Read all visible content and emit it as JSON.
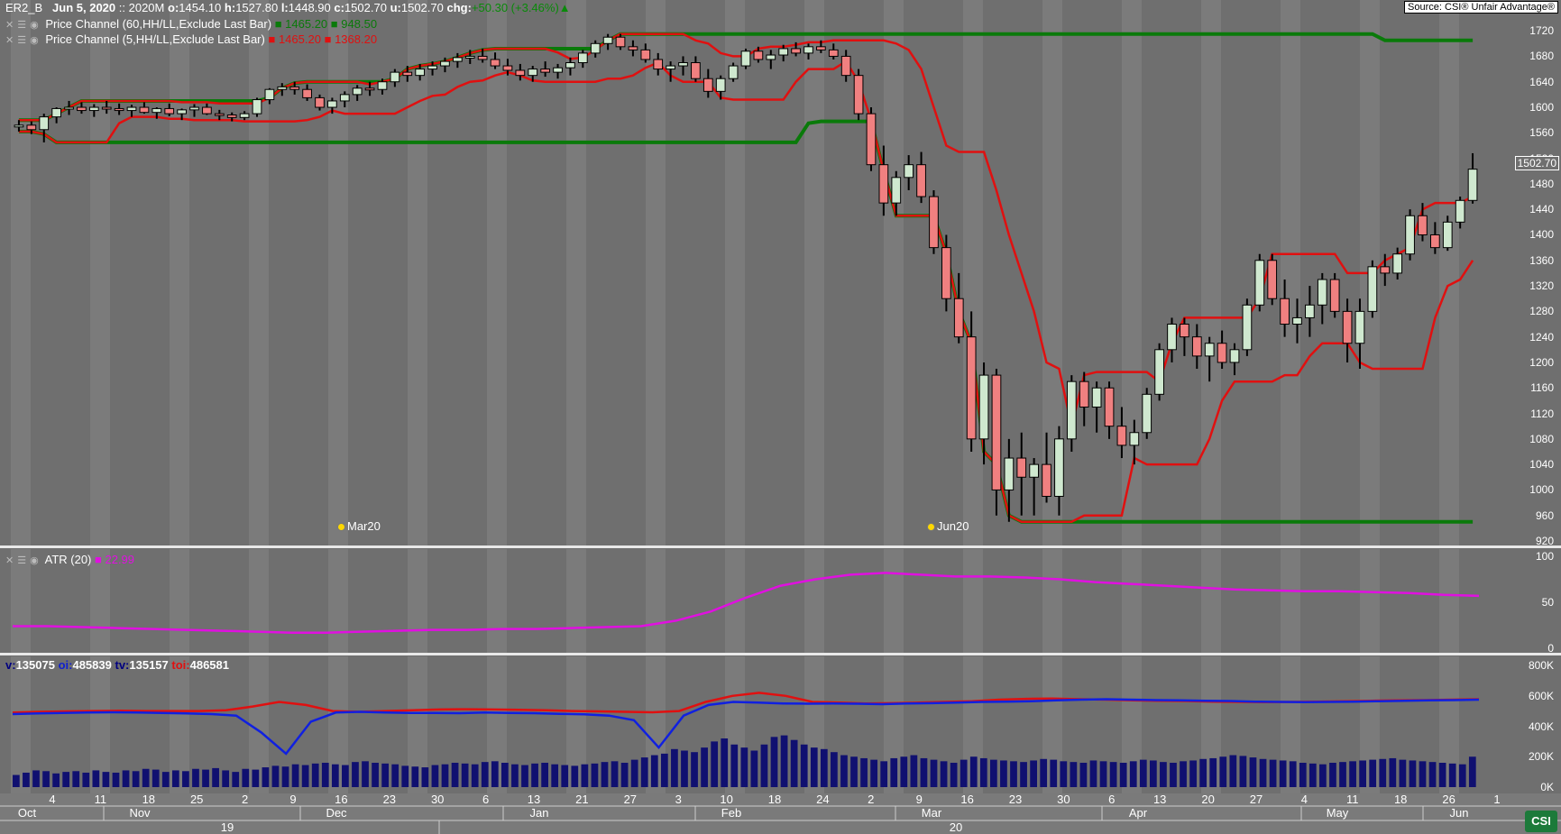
{
  "header": {
    "symbol": "ER2_B",
    "date": "Jun  5, 2020",
    "contract": ":: 2020M",
    "open_label": "o:",
    "open": "1454.10",
    "high_label": "h:",
    "high": "1527.80",
    "low_label": "l:",
    "low": "1448.90",
    "close_label": "c:",
    "close": "1502.70",
    "u_label": "u:",
    "u": "1502.70",
    "chg_label": "chg:",
    "chg": "+50.30 (+3.46%)"
  },
  "source": "Source: CSI® Unfair Advantage®",
  "indicators": {
    "pc60": {
      "label": "Price Channel (60,HH/LL,Exclude Last Bar)",
      "v1": "1465.20",
      "v2": "948.50",
      "color": "#0a7a0a"
    },
    "pc5": {
      "label": "Price Channel (5,HH/LL,Exclude Last Bar)",
      "v1": "1465.20",
      "v2": "1368.20",
      "color": "#e01010"
    },
    "atr": {
      "label": "ATR (20)",
      "value": "22.99",
      "color": "#e010e0"
    }
  },
  "volume_header": {
    "v_label": "v:",
    "v": "135075",
    "oi_label": "oi:",
    "oi": "485839",
    "tv_label": "tv:",
    "tv": "135157",
    "toi_label": "toi:",
    "toi": "486581"
  },
  "last_price_box": "1502.70",
  "markers": [
    {
      "label": "Mar20"
    },
    {
      "label": "Jun20"
    }
  ],
  "price_axis": [
    "1720",
    "1680",
    "1640",
    "1600",
    "1560",
    "1520",
    "1480",
    "1440",
    "1400",
    "1360",
    "1320",
    "1280",
    "1240",
    "1200",
    "1160",
    "1120",
    "1080",
    "1040",
    "1000",
    "960",
    "920"
  ],
  "atr_axis": [
    "100",
    "50",
    "0"
  ],
  "vol_axis": [
    "800K",
    "600K",
    "400K",
    "200K",
    "0K"
  ],
  "time_axis": {
    "days": [
      "4",
      "11",
      "18",
      "25",
      "2",
      "9",
      "16",
      "23",
      "30",
      "6",
      "13",
      "21",
      "27",
      "3",
      "10",
      "18",
      "24",
      "2",
      "9",
      "16",
      "23",
      "30",
      "6",
      "13",
      "20",
      "27",
      "4",
      "11",
      "18",
      "26",
      "1"
    ],
    "months": [
      "Oct",
      "Nov",
      "Dec",
      "Jan",
      "Feb",
      "Mar",
      "Apr",
      "May",
      "Jun"
    ],
    "years": [
      "19",
      "20"
    ]
  },
  "chart_data": {
    "type": "candlestick",
    "ylim": [
      920,
      1740
    ],
    "candles": [
      [
        1570,
        1580,
        1562,
        1572
      ],
      [
        1572,
        1578,
        1558,
        1565
      ],
      [
        1565,
        1590,
        1545,
        1585
      ],
      [
        1585,
        1600,
        1575,
        1598
      ],
      [
        1598,
        1610,
        1588,
        1600
      ],
      [
        1600,
        1608,
        1590,
        1595
      ],
      [
        1595,
        1605,
        1585,
        1600
      ],
      [
        1600,
        1610,
        1590,
        1598
      ],
      [
        1598,
        1606,
        1588,
        1595
      ],
      [
        1595,
        1604,
        1585,
        1600
      ],
      [
        1600,
        1608,
        1590,
        1592
      ],
      [
        1592,
        1600,
        1582,
        1598
      ],
      [
        1598,
        1606,
        1586,
        1590
      ],
      [
        1590,
        1598,
        1580,
        1596
      ],
      [
        1596,
        1605,
        1585,
        1600
      ],
      [
        1600,
        1606,
        1588,
        1590
      ],
      [
        1590,
        1596,
        1580,
        1588
      ],
      [
        1588,
        1592,
        1578,
        1584
      ],
      [
        1584,
        1594,
        1580,
        1590
      ],
      [
        1590,
        1615,
        1585,
        1612
      ],
      [
        1612,
        1630,
        1605,
        1628
      ],
      [
        1628,
        1638,
        1618,
        1632
      ],
      [
        1632,
        1640,
        1620,
        1628
      ],
      [
        1628,
        1636,
        1610,
        1615
      ],
      [
        1615,
        1620,
        1595,
        1600
      ],
      [
        1600,
        1615,
        1590,
        1610
      ],
      [
        1610,
        1625,
        1600,
        1620
      ],
      [
        1620,
        1635,
        1610,
        1630
      ],
      [
        1630,
        1640,
        1618,
        1628
      ],
      [
        1628,
        1645,
        1620,
        1640
      ],
      [
        1640,
        1660,
        1632,
        1655
      ],
      [
        1655,
        1665,
        1640,
        1650
      ],
      [
        1650,
        1668,
        1642,
        1660
      ],
      [
        1660,
        1672,
        1650,
        1665
      ],
      [
        1665,
        1678,
        1655,
        1672
      ],
      [
        1672,
        1685,
        1662,
        1678
      ],
      [
        1678,
        1690,
        1668,
        1680
      ],
      [
        1680,
        1692,
        1670,
        1675
      ],
      [
        1675,
        1686,
        1660,
        1665
      ],
      [
        1665,
        1676,
        1650,
        1658
      ],
      [
        1658,
        1668,
        1642,
        1650
      ],
      [
        1650,
        1665,
        1640,
        1660
      ],
      [
        1660,
        1672,
        1648,
        1655
      ],
      [
        1655,
        1668,
        1645,
        1662
      ],
      [
        1662,
        1678,
        1650,
        1670
      ],
      [
        1670,
        1690,
        1662,
        1685
      ],
      [
        1685,
        1705,
        1678,
        1700
      ],
      [
        1700,
        1715,
        1690,
        1710
      ],
      [
        1710,
        1715,
        1690,
        1695
      ],
      [
        1695,
        1705,
        1680,
        1690
      ],
      [
        1690,
        1700,
        1670,
        1675
      ],
      [
        1675,
        1685,
        1650,
        1660
      ],
      [
        1660,
        1672,
        1640,
        1665
      ],
      [
        1665,
        1680,
        1650,
        1670
      ],
      [
        1670,
        1680,
        1640,
        1645
      ],
      [
        1645,
        1660,
        1615,
        1625
      ],
      [
        1625,
        1650,
        1612,
        1645
      ],
      [
        1645,
        1670,
        1640,
        1665
      ],
      [
        1665,
        1692,
        1660,
        1688
      ],
      [
        1688,
        1695,
        1670,
        1675
      ],
      [
        1675,
        1690,
        1660,
        1682
      ],
      [
        1682,
        1698,
        1672,
        1692
      ],
      [
        1692,
        1702,
        1680,
        1685
      ],
      [
        1685,
        1700,
        1675,
        1695
      ],
      [
        1695,
        1705,
        1685,
        1690
      ],
      [
        1690,
        1700,
        1675,
        1680
      ],
      [
        1680,
        1690,
        1640,
        1650
      ],
      [
        1650,
        1660,
        1580,
        1590
      ],
      [
        1590,
        1600,
        1500,
        1510
      ],
      [
        1510,
        1540,
        1430,
        1450
      ],
      [
        1450,
        1500,
        1430,
        1490
      ],
      [
        1490,
        1525,
        1470,
        1510
      ],
      [
        1510,
        1530,
        1450,
        1460
      ],
      [
        1460,
        1470,
        1370,
        1380
      ],
      [
        1380,
        1400,
        1280,
        1300
      ],
      [
        1300,
        1340,
        1230,
        1240
      ],
      [
        1240,
        1280,
        1060,
        1080
      ],
      [
        1080,
        1200,
        1040,
        1180
      ],
      [
        1180,
        1190,
        960,
        1000
      ],
      [
        1000,
        1080,
        950,
        1050
      ],
      [
        1050,
        1090,
        960,
        1020
      ],
      [
        1020,
        1050,
        960,
        1040
      ],
      [
        1040,
        1090,
        980,
        990
      ],
      [
        990,
        1100,
        960,
        1080
      ],
      [
        1080,
        1180,
        1060,
        1170
      ],
      [
        1170,
        1185,
        1100,
        1130
      ],
      [
        1130,
        1170,
        1090,
        1160
      ],
      [
        1160,
        1170,
        1080,
        1100
      ],
      [
        1100,
        1130,
        1050,
        1070
      ],
      [
        1070,
        1110,
        1040,
        1090
      ],
      [
        1090,
        1160,
        1080,
        1150
      ],
      [
        1150,
        1230,
        1140,
        1220
      ],
      [
        1220,
        1270,
        1200,
        1260
      ],
      [
        1260,
        1270,
        1210,
        1240
      ],
      [
        1240,
        1260,
        1190,
        1210
      ],
      [
        1210,
        1240,
        1170,
        1230
      ],
      [
        1230,
        1250,
        1190,
        1200
      ],
      [
        1200,
        1230,
        1180,
        1220
      ],
      [
        1220,
        1300,
        1210,
        1290
      ],
      [
        1290,
        1370,
        1280,
        1360
      ],
      [
        1360,
        1370,
        1290,
        1300
      ],
      [
        1300,
        1330,
        1240,
        1260
      ],
      [
        1260,
        1300,
        1230,
        1270
      ],
      [
        1270,
        1320,
        1240,
        1290
      ],
      [
        1290,
        1340,
        1260,
        1330
      ],
      [
        1330,
        1340,
        1270,
        1280
      ],
      [
        1280,
        1300,
        1200,
        1230
      ],
      [
        1230,
        1300,
        1190,
        1280
      ],
      [
        1280,
        1360,
        1270,
        1350
      ],
      [
        1350,
        1370,
        1320,
        1340
      ],
      [
        1340,
        1380,
        1330,
        1370
      ],
      [
        1370,
        1440,
        1360,
        1430
      ],
      [
        1430,
        1450,
        1390,
        1400
      ],
      [
        1400,
        1420,
        1370,
        1380
      ],
      [
        1380,
        1430,
        1375,
        1420
      ],
      [
        1420,
        1460,
        1410,
        1454
      ],
      [
        1454,
        1528,
        1449,
        1503
      ]
    ],
    "series": [
      {
        "name": "pc60 high"
      },
      {
        "name": "pc60 low"
      },
      {
        "name": "pc5 high"
      },
      {
        "name": "pc5 low"
      },
      {
        "name": "ATR (20)",
        "values": [
          24,
          24,
          23,
          22,
          21,
          20,
          19,
          18,
          17,
          17,
          18,
          19,
          20,
          20,
          21,
          21,
          22,
          23,
          24,
          30,
          40,
          55,
          68,
          75,
          80,
          82,
          80,
          78,
          78,
          77,
          75,
          72,
          70,
          68,
          66,
          64,
          63,
          62,
          62,
          61,
          60,
          58,
          57
        ]
      },
      {
        "name": "oi",
        "values": [
          480,
          485,
          488,
          490,
          492,
          490,
          488,
          485,
          480,
          470,
          360,
          220,
          430,
          490,
          495,
          490,
          488,
          487,
          486,
          490,
          488,
          486,
          482,
          478,
          470,
          440,
          260,
          470,
          540,
          560,
          555,
          550,
          548,
          550,
          548,
          545,
          550,
          552,
          555,
          560,
          562,
          565,
          570,
          575,
          578,
          575,
          572,
          570,
          568,
          566,
          562,
          560,
          558,
          560,
          562,
          565,
          568,
          570,
          572,
          575
        ]
      },
      {
        "name": "toi",
        "values": [
          490,
          495,
          498,
          500,
          502,
          500,
          500,
          500,
          505,
          530,
          560,
          540,
          500,
          495,
          500,
          505,
          510,
          512,
          510,
          508,
          505,
          500,
          498,
          495,
          492,
          500,
          560,
          600,
          620,
          600,
          560,
          555,
          550,
          552,
          555,
          560,
          565,
          575,
          580,
          582,
          578,
          575,
          570,
          568,
          566,
          562,
          560,
          558,
          560,
          562,
          565,
          568,
          570,
          572,
          575,
          578
        ]
      },
      {
        "name": "volume",
        "values": [
          80,
          95,
          110,
          105,
          90,
          100,
          105,
          95,
          110,
          100,
          95,
          110,
          105,
          120,
          115,
          100,
          110,
          105,
          120,
          115,
          125,
          110,
          100,
          120,
          115,
          130,
          140,
          135,
          150,
          145,
          155,
          160,
          150,
          145,
          165,
          170,
          160,
          155,
          150,
          140,
          135,
          130,
          145,
          150,
          160,
          155,
          150,
          165,
          170,
          160,
          150,
          145,
          155,
          160,
          150,
          145,
          140,
          150,
          155,
          165,
          170,
          160,
          180,
          195,
          210,
          220,
          250,
          240,
          230,
          260,
          300,
          320,
          280,
          260,
          240,
          280,
          330,
          340,
          310,
          280,
          260,
          250,
          230,
          210,
          200,
          190,
          180,
          170,
          190,
          200,
          210,
          190,
          180,
          170,
          160,
          180,
          200,
          190,
          180,
          175,
          170,
          165,
          175,
          185,
          180,
          170,
          165,
          160,
          175,
          170,
          165,
          160,
          170,
          180,
          175,
          165,
          160,
          170,
          175,
          185,
          190,
          200,
          210,
          205,
          195,
          185,
          180,
          175,
          170,
          160,
          155,
          150,
          160,
          165,
          170,
          175,
          180,
          185,
          190,
          180,
          175,
          170,
          165,
          160,
          155,
          150,
          200
        ]
      }
    ]
  }
}
